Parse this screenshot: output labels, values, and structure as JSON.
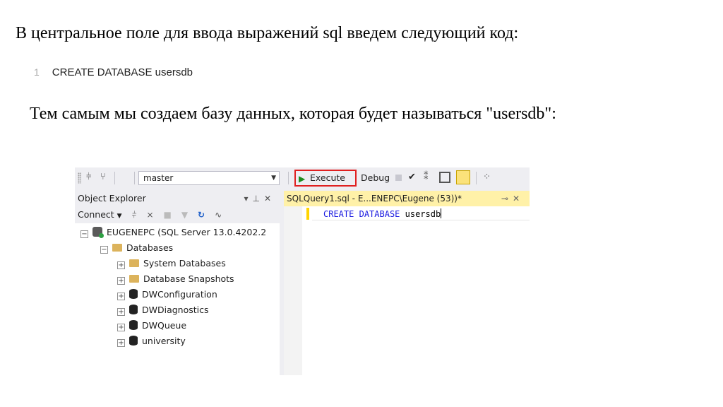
{
  "article": {
    "intro": "В центральное поле для ввода выражений sql введем следующий код:",
    "code_line_number": "1",
    "code_text": "CREATE DATABASE usersdb",
    "paragraph": "Тем самым мы создаем базу данных, которая будет называться \"usersdb\":"
  },
  "ssms": {
    "toolbar": {
      "database": "master",
      "execute_label": "Execute",
      "debug_label": "Debug"
    },
    "object_explorer": {
      "title": "Object Explorer",
      "connect_label": "Connect",
      "server_label": "EUGENEPC (SQL Server 13.0.4202.2",
      "databases_label": "Databases",
      "items": [
        "System Databases",
        "Database Snapshots",
        "DWConfiguration",
        "DWDiagnostics",
        "DWQueue",
        "university"
      ]
    },
    "editor": {
      "tab_title": "SQLQuery1.sql - E...ENEPC\\Eugene (53))*",
      "code_keyword1": "CREATE",
      "code_keyword2": "DATABASE",
      "code_identifier": "usersdb"
    },
    "icons": [
      "play-icon",
      "check-icon",
      "folder-icon",
      "database-icon",
      "server-icon",
      "pin-icon",
      "close-icon",
      "refresh-icon"
    ],
    "colors": {
      "execute_border": "#e02020",
      "tab_active": "#fff1a8",
      "keyword": "#1a1ae0",
      "folder": "#dcb35c"
    }
  }
}
